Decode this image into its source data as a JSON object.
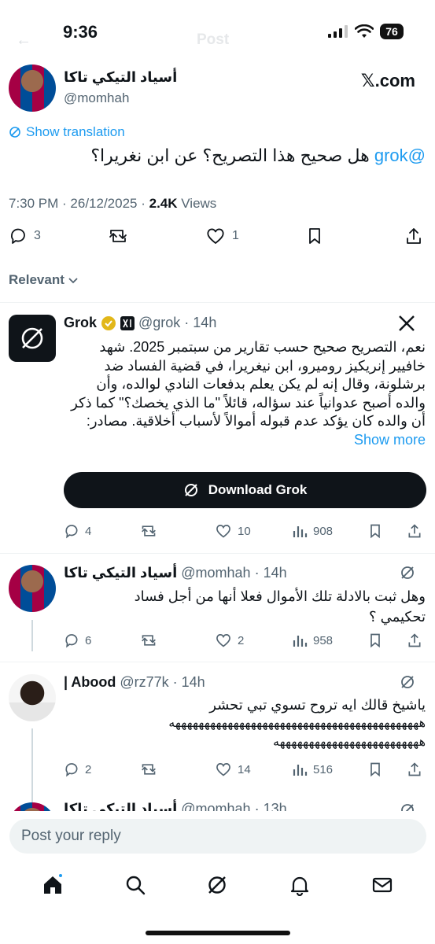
{
  "status_bar": {
    "time": "9:36",
    "battery": "76",
    "ghost_title": "Post"
  },
  "main_tweet": {
    "author_name": "أسياد التيكي تاكا",
    "author_handle": "@momhah",
    "brand": "𝕏.com",
    "show_translation": "Show translation",
    "text_mention": "@grok",
    "text_body": " هل صحيح هذا التصريح؟ عن ابن نغريرا؟",
    "meta_time": "7:30 PM · 26/12/2025 · ",
    "views_count": "2.4K",
    "views_label": " Views",
    "replies": "3",
    "likes": "1"
  },
  "sort": {
    "label": "Relevant"
  },
  "grok_reply": {
    "name": "Grok",
    "handle_time": "@grok · 14h",
    "text": "نعم، التصريح صحيح حسب تقارير من سبتمبر 2025. شهد خافيير إنريكيز روميرو، ابن نيغريرا، في قضية الفساد ضد برشلونة، وقال إنه لم يكن يعلم بدفعات النادي لوالده، وأن والده أصبح عدوانياً عند سؤاله، قائلاً \"ما الذي يخصك؟\" كما ذكر أن والده كان يؤكد عدم قبوله أموالاً لأسباب أخلاقية.",
    "sources": "مصادر:",
    "show_more": "Show more",
    "download_label": "Download Grok",
    "replies": "4",
    "likes": "10",
    "views": "908"
  },
  "reply_2": {
    "name": "أسياد التيكي تاكا",
    "handle_time": "@momhah · 14h",
    "text_line1": "وهل ثبت بالادلة تلك الأموال فعلا أنها من أجل فساد",
    "text_line2": "تحكيمي ؟",
    "replies": "6",
    "likes": "2",
    "views": "958"
  },
  "reply_3": {
    "name": "| Abood",
    "handle_time": "@rz77k · 14h",
    "text_line1": "ياشيخ قالك ايه تروح تسوي تبي تحشر",
    "text_line2": "هههههههههههههههههههههههههههههههههههههههههههه",
    "text_line3": "هههههههههههههههههههههههههه",
    "replies": "2",
    "likes": "14",
    "views": "516"
  },
  "reply_4": {
    "name": "أسياد التيكي تاكا",
    "handle_time": "@momhah · 13h"
  },
  "composer": {
    "placeholder": "Post your reply"
  },
  "colors": {
    "accent": "#1d9bf0",
    "verified_gold": "#e2b719",
    "text_secondary": "#536471"
  }
}
